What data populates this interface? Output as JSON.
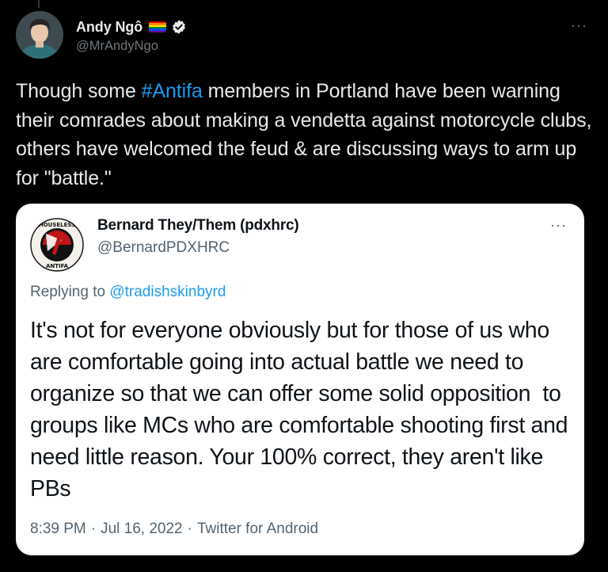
{
  "tweet": {
    "author_name": "Andy Ngô",
    "author_handle": "@MrAndyNgo",
    "text_before_hashtag": "Though some ",
    "hashtag": "#Antifa",
    "text_after_hashtag": " members in Portland have been warning their comrades about making a vendetta against motorcycle clubs, others have welcomed the feud & are discussing ways to arm up for \"battle.\"",
    "more_label": "···"
  },
  "quoted_tweet": {
    "author_name": "Bernard They/Them (pdxhrc)",
    "author_handle": "@BernardPDXHRC",
    "more_label": "···",
    "replying_to_label": "Replying to ",
    "replying_to_handle": "@tradishskinbyrd",
    "text": "It's not for everyone obviously but for those of us who are comfortable going into actual battle we need to organize so that we can offer some solid opposition  to groups like MCs who are comfortable shooting first and need little reason. Your 100% correct, they aren't like PBs",
    "time": "8:39 PM",
    "separator": "·",
    "date": "Jul 16, 2022",
    "source": "Twitter for Android",
    "avatar_text_top": "HOUSELESS",
    "avatar_text_bottom": "ANTIFA"
  },
  "colors": {
    "background": "#000000",
    "link": "#1d9bf0",
    "verified": "#e7e9ea",
    "card": "#ffffff"
  },
  "icons": {
    "verified": "verified-badge-icon",
    "flag": "rainbow-flag-icon",
    "more": "more-options-icon"
  }
}
